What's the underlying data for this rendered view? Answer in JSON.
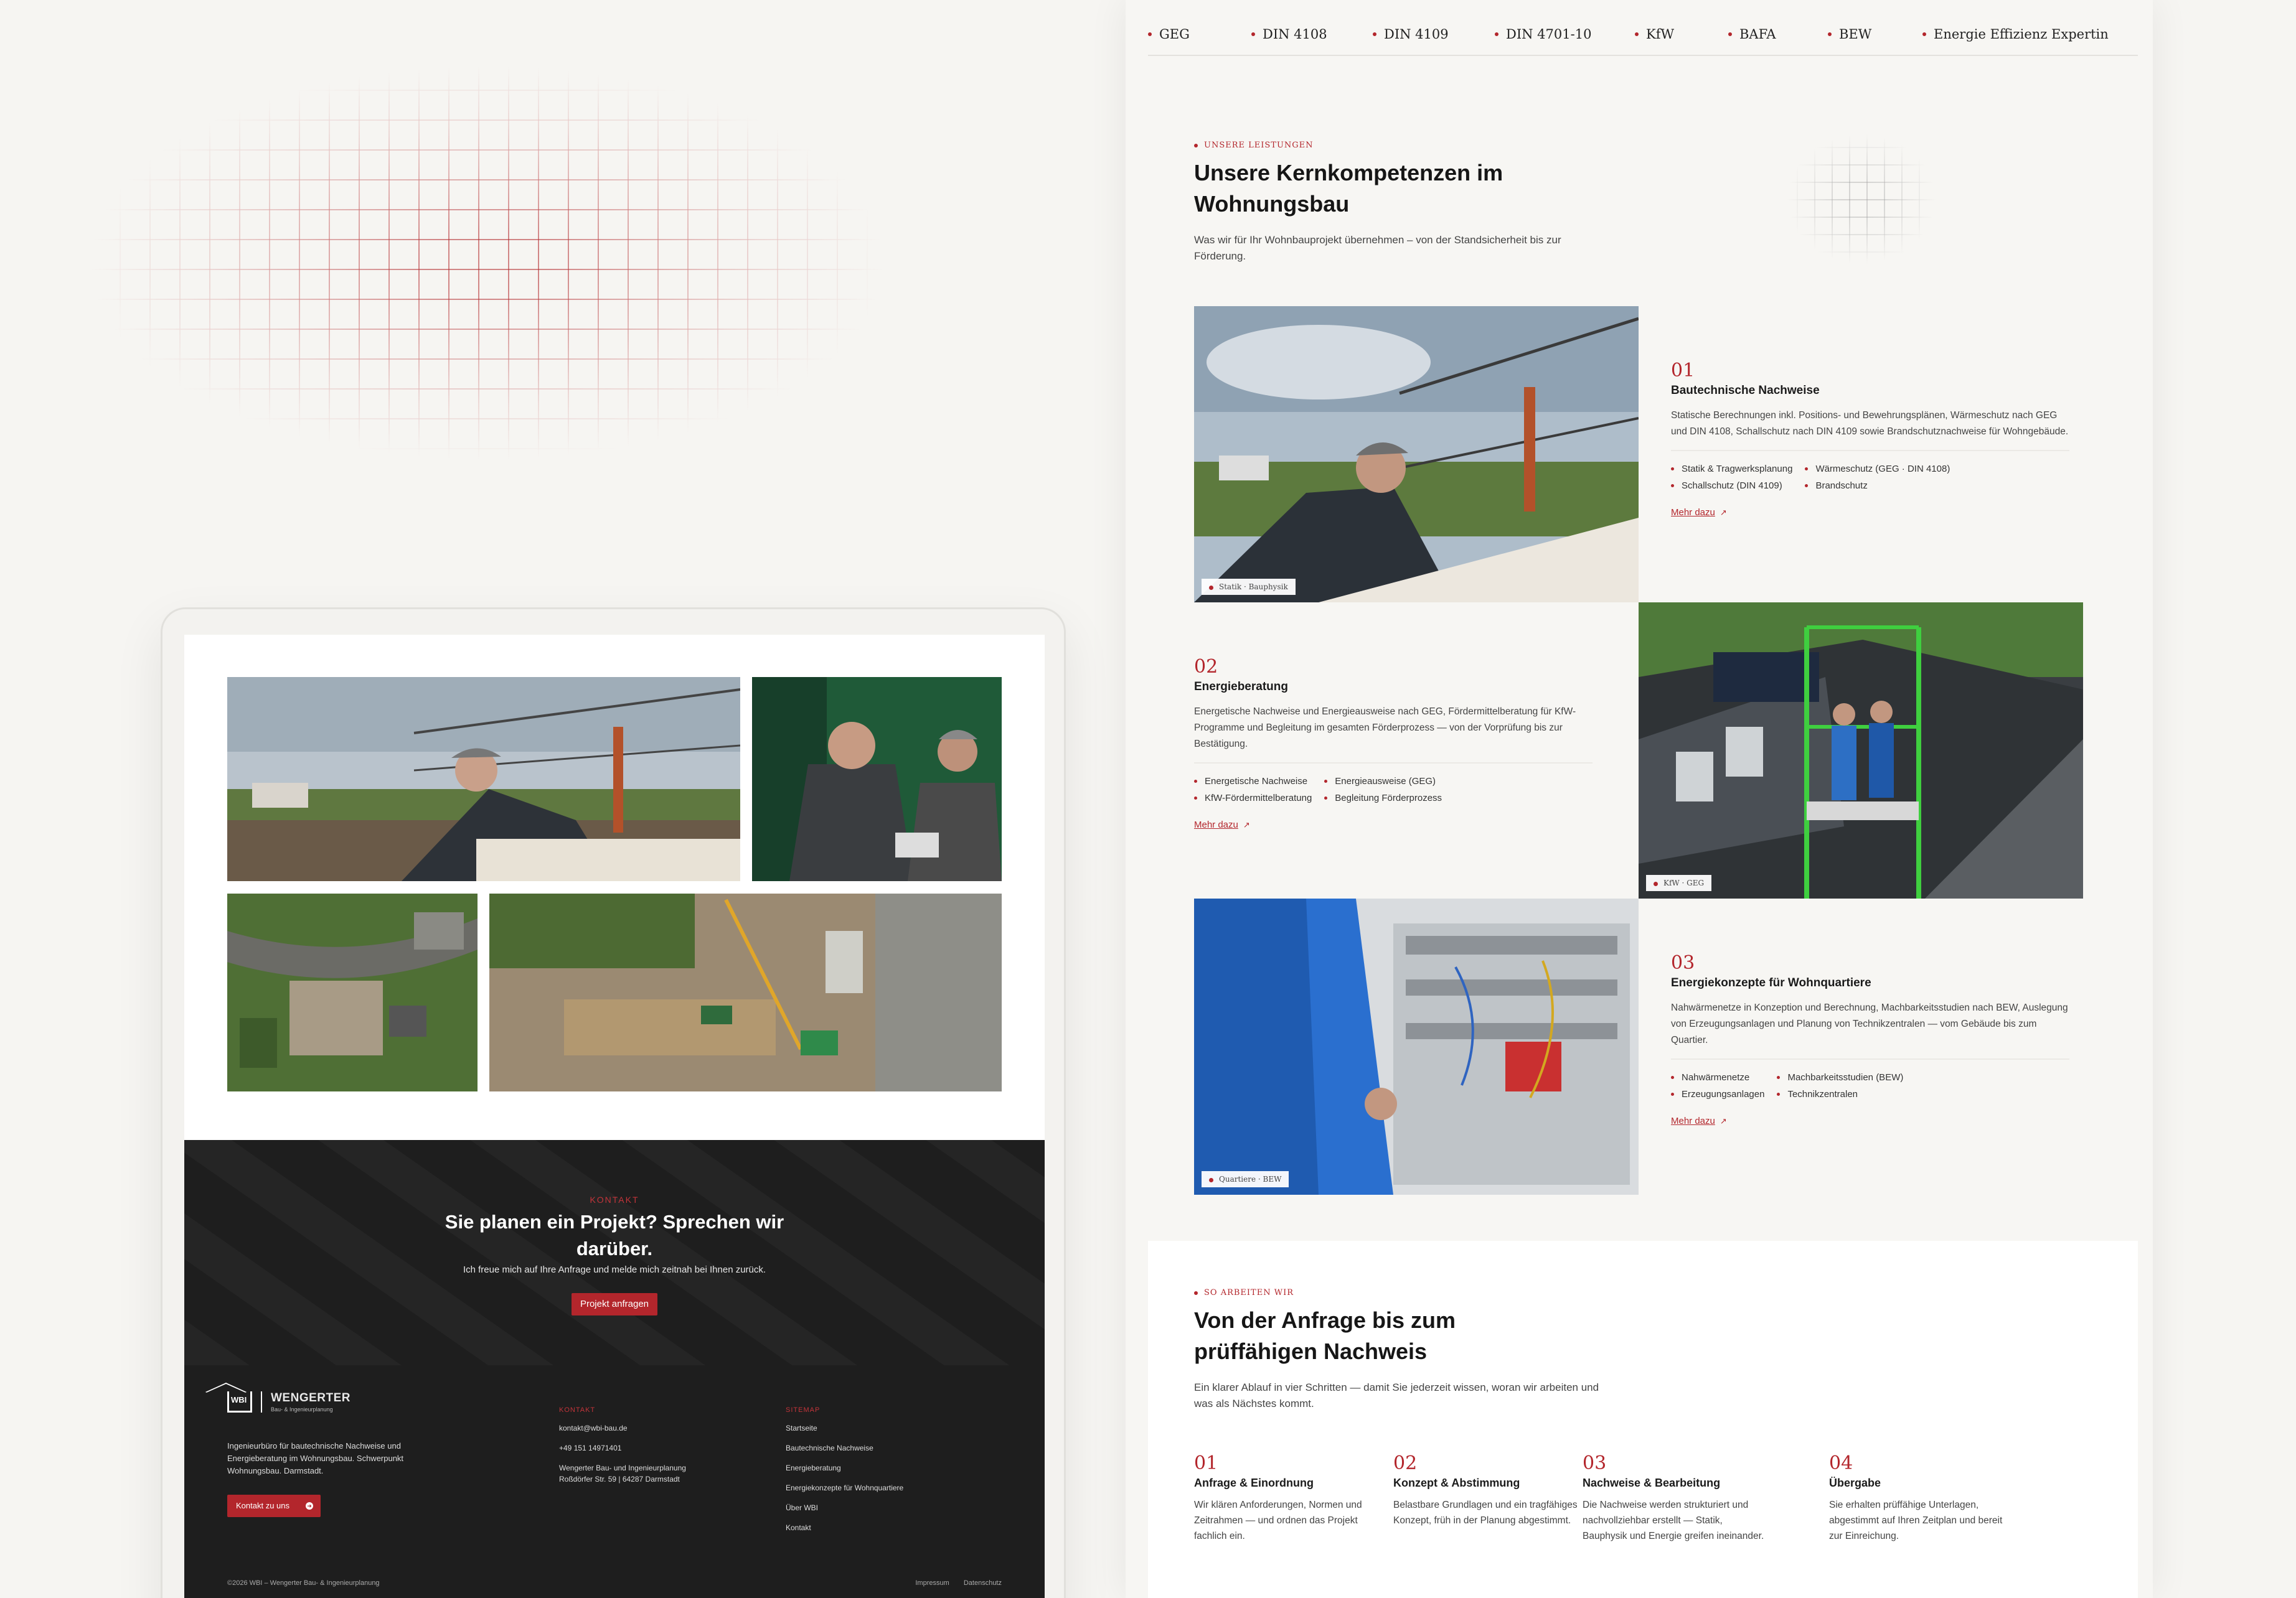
{
  "left_mock": {
    "cta": {
      "eyebrow": "KONTAKT",
      "title": "Sie planen ein Projekt? Sprechen wir darüber.",
      "text": "Ich freue mich auf Ihre Anfrage und melde mich zeitnah bei Ihnen zurück.",
      "button": "Projekt anfragen"
    },
    "footer": {
      "logo_mark": "WBI",
      "logo_name": "WENGERTER",
      "logo_sub": "Bau- & Ingenieurplanung",
      "description": "Ingenieurbüro für bautechnische Nachweise und Energieberatung im Wohnungsbau. Schwerpunkt Wohnungsbau. Darmstadt.",
      "button": "Kontakt zu uns",
      "contact_heading": "KONTAKT",
      "email": "kontakt@wbi-bau.de",
      "phone": "+49 151 14971401",
      "company": "Wengerter Bau- und Ingenieurplanung",
      "address": "Roßdörfer Str. 59 | 64287 Darmstadt",
      "sitemap_heading": "SITEMAP",
      "sitemap": [
        "Startseite",
        "Bautechnische Nachweise",
        "Energieberatung",
        "Energiekonzepte für Wohnquartiere",
        "Über WBI",
        "Kontakt"
      ],
      "copyright": "©2026 WBI – Wengerter Bau- & Ingenieurplanung",
      "impressum": "Impressum",
      "datenschutz": "Datenschutz"
    }
  },
  "norms": [
    "GEG",
    "DIN 4108",
    "DIN 4109",
    "DIN 4701-10",
    "KfW",
    "BAFA",
    "BEW",
    "Energie Effizienz Expertin"
  ],
  "services_section": {
    "eyebrow": "UNSERE LEISTUNGEN",
    "title_line1": "Unsere Kernkompetenzen im",
    "title_line2": "Wohnungsbau",
    "lead_line1": "Was wir für Ihr Wohnbauprojekt übernehmen – von der Standsicherheit bis zur",
    "lead_line2": "Förderung.",
    "services": [
      {
        "num": "01",
        "title": "Bautechnische Nachweise",
        "desc": "Statische Berechnungen inkl. Positions- und Bewehrungsplänen, Wärmeschutz nach GEG und DIN 4108, Schallschutz nach DIN 4109 sowie Brandschutznachweise für Wohngebäude.",
        "bullets": [
          "Statik & Tragwerksplanung",
          "Wärmeschutz (GEG · DIN 4108)",
          "Schallschutz (DIN 4109)",
          "Brandschutz"
        ],
        "more": "Mehr dazu",
        "tag": "Statik · Bauphysik"
      },
      {
        "num": "02",
        "title": "Energieberatung",
        "desc": "Energetische Nachweise und Energieausweise nach GEG, Fördermittelberatung für KfW-Programme und Begleitung im gesamten Förderprozess — von der Vorprüfung bis zur Bestätigung.",
        "bullets": [
          "Energetische Nachweise",
          "Energieausweise (GEG)",
          "KfW-Fördermittelberatung",
          "Begleitung Förderprozess"
        ],
        "more": "Mehr dazu",
        "tag": "KfW · GEG"
      },
      {
        "num": "03",
        "title": "Energiekonzepte für Wohnquartiere",
        "desc": "Nahwärmenetze in Konzeption und Berechnung, Machbarkeitsstudien nach BEW, Auslegung von Erzeugungsanlagen und Planung von Technikzentralen — vom Gebäude bis zum Quartier.",
        "bullets": [
          "Nahwärmenetze",
          "Machbarkeitsstudien (BEW)",
          "Erzeugungsanlagen",
          "Technikzentralen"
        ],
        "more": "Mehr dazu",
        "tag": "Quartiere · BEW"
      }
    ]
  },
  "process": {
    "eyebrow": "SO ARBEITEN WIR",
    "title_line1": "Von der Anfrage bis zum",
    "title_line2": "prüffähigen Nachweis",
    "lead_line1": "Ein klarer Ablauf in vier Schritten — damit Sie jederzeit wissen, woran wir arbeiten und",
    "lead_line2": "was als Nächstes kommt.",
    "steps": [
      {
        "num": "01",
        "title": "Anfrage & Einordnung",
        "desc": "Wir klären Anforderungen, Normen und Zeitrahmen — und ordnen das Projekt fachlich ein."
      },
      {
        "num": "02",
        "title": "Konzept & Abstimmung",
        "desc": "Belastbare Grundlagen und ein tragfähiges Konzept, früh in der Planung abgestimmt."
      },
      {
        "num": "03",
        "title": "Nachweise & Bearbeitung",
        "desc": "Die Nachweise werden strukturiert und nachvollziehbar erstellt — Statik, Bauphysik und Energie greifen ineinander."
      },
      {
        "num": "04",
        "title": "Übergabe",
        "desc": "Sie erhalten prüffähige Unterlagen, abgestimmt auf Ihren Zeitplan und bereit zur Einreichung."
      }
    ]
  },
  "colors": {
    "accent": "#b3262c",
    "dark": "#1e1e1e",
    "page_bg": "#f7f6f3"
  }
}
